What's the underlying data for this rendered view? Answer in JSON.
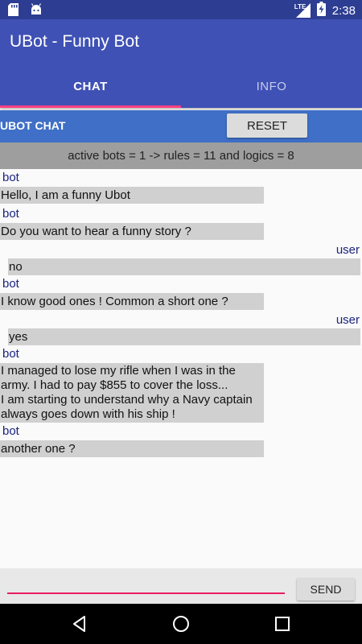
{
  "status_bar": {
    "time": "2:38",
    "network": "LTE",
    "icons": [
      "sd-card-icon",
      "android-icon",
      "signal-icon",
      "battery-charging-icon"
    ]
  },
  "app_bar": {
    "title": "UBot - Funny Bot"
  },
  "tabs": [
    {
      "label": "CHAT",
      "active": true
    },
    {
      "label": "INFO",
      "active": false
    }
  ],
  "chat_header": {
    "label": "UBOT CHAT",
    "reset_label": "RESET"
  },
  "info_bar": {
    "text": "active bots = 1 -> rules = 11 and logics = 8"
  },
  "messages": [
    {
      "sender": "bot",
      "text": "Hello, I am a funny Ubot"
    },
    {
      "sender": "bot",
      "text": "Do you want to hear a funny story ?"
    },
    {
      "sender": "user",
      "text": "no"
    },
    {
      "sender": "bot",
      "text": "I know good ones ! Common a short one ?"
    },
    {
      "sender": "user",
      "text": "yes"
    },
    {
      "sender": "bot",
      "text": "I managed to lose my rifle when I was in the army. I had to pay $855 to cover the loss...\nI am starting to understand why a Navy captain always goes down with his ship !"
    },
    {
      "sender": "bot",
      "text": "another one ?"
    }
  ],
  "input": {
    "value": "",
    "send_label": "SEND"
  },
  "colors": {
    "status_bar": "#2d3d91",
    "app_bar": "#3f51b5",
    "tab_indicator": "#ff4081",
    "chat_header": "#3f6fc6",
    "info_bar": "#9e9e9e",
    "bubble": "#d0d0d0",
    "sender_text": "#1a237e",
    "input_underline": "#e91e63"
  }
}
